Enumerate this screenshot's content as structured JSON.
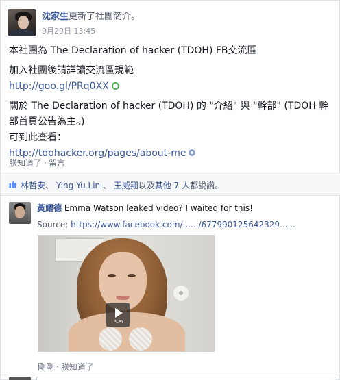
{
  "post": {
    "author": "沈家生",
    "action": "更新了社團簡介。",
    "time": "9月29日 13:45",
    "body": {
      "line1": "本社團為 The Declaration of hacker (TDOH) FB交流區",
      "line2": "加入社團後請詳讀交流區規範",
      "link1": "http://goo.gl/PRq0XX",
      "line3": "關於 The Declaration of hacker (TDOH) 的 \"介紹\" 與 \"幹部\" (TDOH 幹",
      "line4": "部首頁公告為主。)",
      "line5": "可到此查看：",
      "link2": "http://tdohacker.org/pages/about-me"
    },
    "actions": {
      "like": "朕知道了",
      "sep": "·",
      "comment": "留言"
    }
  },
  "likes": {
    "name1": "林哲安",
    "sep1": "、",
    "name2": "Ying Yu Lin",
    "sep2": "、",
    "name3": "王威翔",
    "and": "以及",
    "others": "其他 7 人",
    "suffix": "都說讚。"
  },
  "comment": {
    "author": "黃耀德",
    "text": "Emma Watson leaked video? I waited for this!",
    "source_label": "Source:",
    "source_link": "https://www.facebook.com/....../677990125642329......",
    "play_label": "PLAY",
    "actions": {
      "time": "剛剛",
      "sep": "·",
      "like": "朕知道了"
    }
  },
  "colors": {
    "link": "#3b5998",
    "muted": "#9197a3",
    "likes_bg": "#f6f7f8"
  },
  "icons": {
    "external_link": "green-circle-icon",
    "privacy": "globe-icon",
    "like": "thumbs-up-icon",
    "video_play": "play-icon"
  }
}
